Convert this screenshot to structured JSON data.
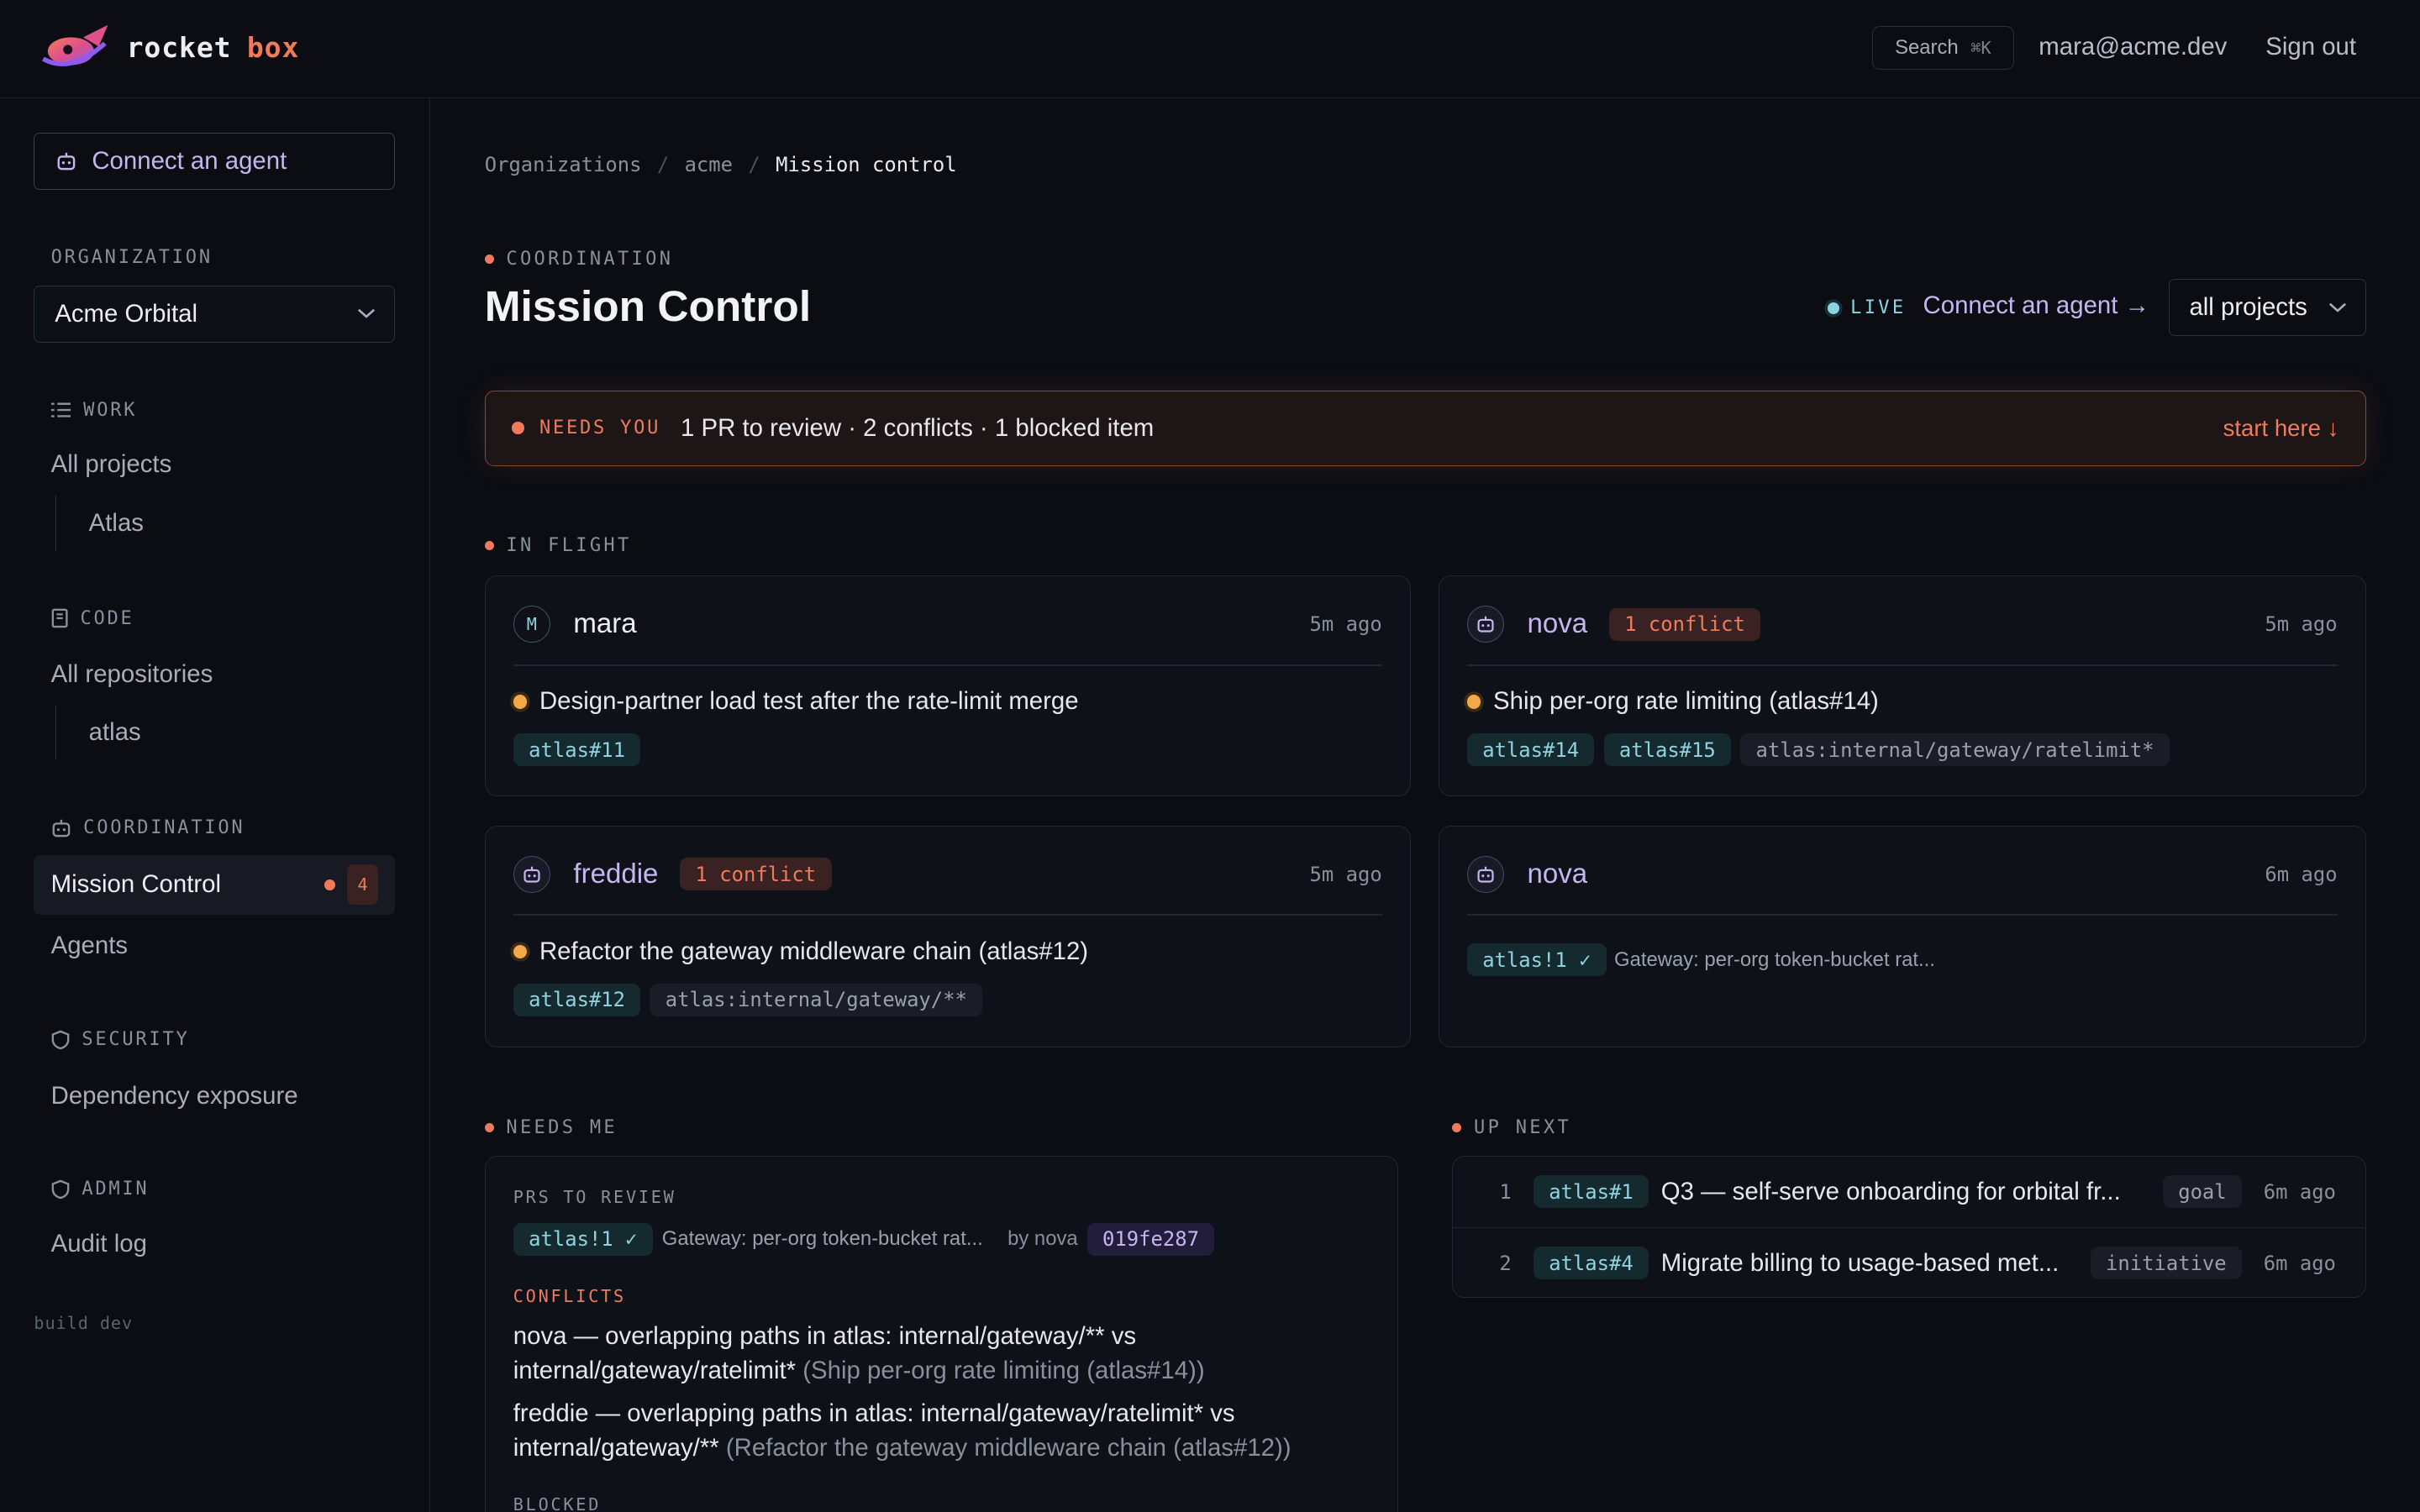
{
  "brand": {
    "word1": "rocket",
    "word2": "box"
  },
  "topbar": {
    "search_label": "Search",
    "search_shortcut": "⌘K",
    "user_email": "mara@acme.dev",
    "signout": "Sign out"
  },
  "sidebar": {
    "connect_agent": "Connect an agent",
    "organization_label": "ORGANIZATION",
    "organization_value": "Acme Orbital",
    "work_label": "WORK",
    "all_projects": "All projects",
    "project_atlas": "Atlas",
    "code_label": "CODE",
    "all_repositories": "All repositories",
    "repo_atlas": "atlas",
    "coordination_label": "COORDINATION",
    "mission_control": "Mission Control",
    "mission_control_count": "4",
    "agents": "Agents",
    "security_label": "SECURITY",
    "dependency_exposure": "Dependency exposure",
    "admin_label": "ADMIN",
    "audit_log": "Audit log",
    "build": "build dev"
  },
  "breadcrumb": {
    "item1": "Organizations",
    "item2": "acme",
    "item3": "Mission control",
    "sep": "/"
  },
  "header": {
    "kicker": "COORDINATION",
    "title": "Mission Control",
    "live": "LIVE",
    "connect_link": "Connect an agent →",
    "project_filter": "all projects"
  },
  "needs_banner": {
    "tag": "NEEDS YOU",
    "summary": "1 PR to review · 2 conflicts · 1 blocked item",
    "action": "start here ↓"
  },
  "in_flight": {
    "label": "IN FLIGHT",
    "cards": [
      {
        "name": "mara",
        "avatar": "M",
        "time": "5m ago",
        "task": "Design-partner load test after the rate-limit merge",
        "chips": [
          "atlas#11"
        ]
      },
      {
        "name": "nova",
        "conflict": "1 conflict",
        "time": "5m ago",
        "task": "Ship per-org rate limiting (atlas#14)",
        "chips": [
          "atlas#14",
          "atlas#15"
        ],
        "path": "atlas:internal/gateway/ratelimit*"
      },
      {
        "name": "freddie",
        "conflict": "1 conflict",
        "time": "5m ago",
        "task": "Refactor the gateway middleware chain (atlas#12)",
        "chips": [
          "atlas#12"
        ],
        "path": "atlas:internal/gateway/**"
      },
      {
        "name": "nova",
        "time": "6m ago",
        "pr_chip": "atlas!1 ✓",
        "pr_title": "Gateway: per-org token-bucket rat..."
      }
    ]
  },
  "needs_me": {
    "label": "NEEDS ME",
    "prs_label": "PRS TO REVIEW",
    "pr_chip": "atlas!1 ✓",
    "pr_title": "Gateway: per-org token-bucket rat...",
    "pr_by": "by nova",
    "pr_sha": "019fe287",
    "conflicts_label": "CONFLICTS",
    "conflicts": [
      {
        "who": "nova",
        "text": " — overlapping paths in atlas: internal/gateway/** vs internal/gateway/ratelimit* ",
        "context": "(Ship per-org rate limiting (atlas#14))"
      },
      {
        "who": "freddie",
        "text": " — overlapping paths in atlas: internal/gateway/ratelimit* vs internal/gateway/** ",
        "context": "(Refactor the gateway middleware chain (atlas#12))"
      }
    ],
    "blocked_label": "BLOCKED"
  },
  "up_next": {
    "label": "UP NEXT",
    "rows": [
      {
        "num": "1",
        "chip": "atlas#1",
        "title": "Q3 — self-serve onboarding for orbital fr...",
        "kind": "goal",
        "time": "6m ago"
      },
      {
        "num": "2",
        "chip": "atlas#4",
        "title": "Migrate billing to usage-based met...",
        "kind": "initiative",
        "time": "6m ago"
      }
    ]
  },
  "colors": {
    "background": "#0b0d13",
    "accent_orange": "#f07b5c",
    "accent_purple": "#c5b6f0",
    "accent_teal": "#8fd3e0",
    "status_amber": "#f2a94a"
  }
}
